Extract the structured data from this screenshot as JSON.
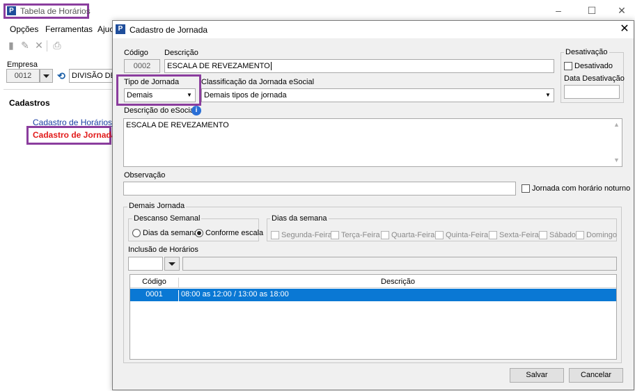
{
  "main_window": {
    "title": "Tabela de Horários",
    "menu": [
      "Opções",
      "Ferramentas",
      "Ajuc"
    ],
    "empresa": {
      "label": "Empresa",
      "code": "0012",
      "name": "DIVISÃO DE F"
    },
    "sidebar": {
      "heading": "Cadastros",
      "items": [
        "Cadastro de Horários",
        "Cadastro de Jornadas"
      ]
    }
  },
  "dialog": {
    "title": "Cadastro de Jornada",
    "codigo": {
      "label": "Código",
      "value": "0002"
    },
    "descricao": {
      "label": "Descrição",
      "value": "ESCALA DE REVEZAMENTO"
    },
    "desativacao": {
      "legend": "Desativação",
      "desativado_label": "Desativado",
      "data_label": "Data Desativação",
      "data_value": ""
    },
    "tipo_jornada": {
      "label": "Tipo de Jornada",
      "value": "Demais"
    },
    "classificacao": {
      "label": "Classificação da Jornada eSocial",
      "value": "Demais tipos de jornada"
    },
    "descricao_esocial": {
      "label": "Descrição do eSocial",
      "value": "ESCALA DE REVEZAMENTO"
    },
    "observacao": {
      "label": "Observação",
      "value": ""
    },
    "noturno_label": "Jornada com horário noturno",
    "demais": {
      "legend": "Demais Jornada",
      "descanso": {
        "legend": "Descanso Semanal",
        "options": [
          "Dias da semana",
          "Conforme escala"
        ],
        "selected": "Conforme escala"
      },
      "dias": {
        "legend": "Dias da semana",
        "items": [
          "Segunda-Feira",
          "Terça-Feira",
          "Quarta-Feira",
          "Quinta-Feira",
          "Sexta-Feira",
          "Sábado",
          "Domingo"
        ]
      },
      "inclusao_label": "Inclusão de Horários",
      "grid": {
        "columns": [
          "Código",
          "Descrição"
        ],
        "rows": [
          {
            "codigo": "0001",
            "descricao": "08:00 as 12:00 / 13:00 as 18:00"
          }
        ]
      }
    },
    "buttons": {
      "save": "Salvar",
      "cancel": "Cancelar"
    }
  }
}
